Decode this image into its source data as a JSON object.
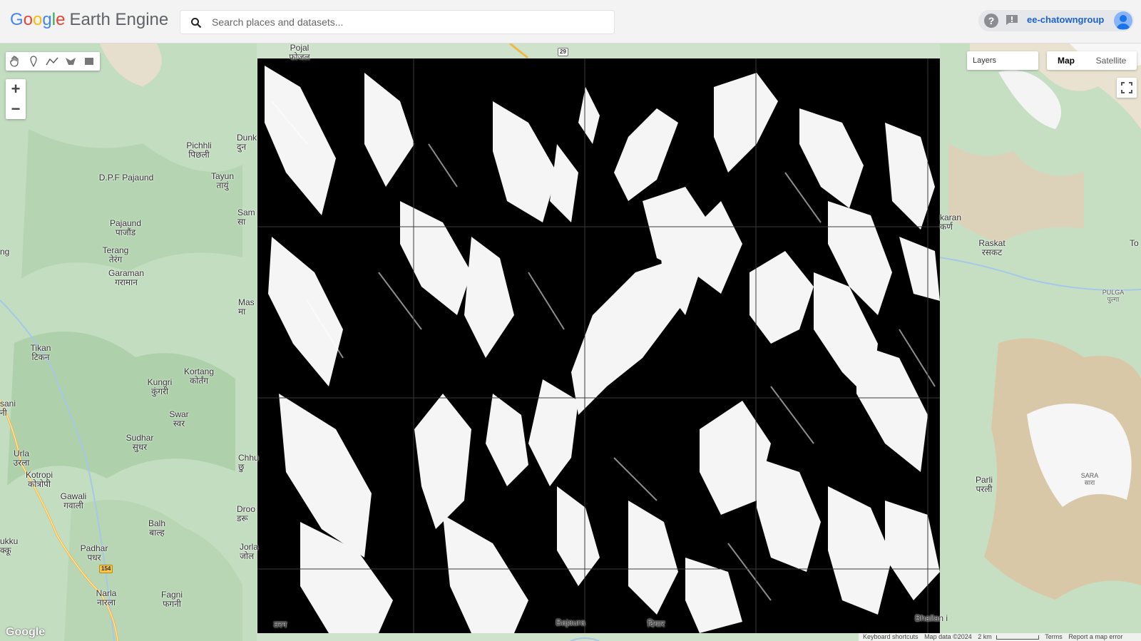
{
  "app": {
    "logo_google": [
      "G",
      "o",
      "o",
      "g",
      "l",
      "e"
    ],
    "logo_product": "Earth Engine"
  },
  "search": {
    "placeholder": "Search places and datasets..."
  },
  "account": {
    "help_glyph": "?",
    "username": "ee-chatowngroup"
  },
  "map_controls": {
    "tools": [
      "pan-hand",
      "point-marker",
      "line",
      "polygon",
      "rectangle"
    ],
    "zoom_in": "+",
    "zoom_out": "−",
    "layers_label": "Layers",
    "map_type": {
      "active": "Map",
      "other": "Satellite"
    }
  },
  "places": [
    {
      "name": "Pojal",
      "sub": "फोजल"
    },
    {
      "name": "Dunk",
      "sub": "दुन"
    },
    {
      "name": "Pichhli",
      "sub": "पिछली"
    },
    {
      "name": "D.P.F Pajaund",
      "sub": ""
    },
    {
      "name": "Tayun",
      "sub": "तायुं"
    },
    {
      "name": "Sam",
      "sub": "सा"
    },
    {
      "name": "Pajaund",
      "sub": "पाजौंड"
    },
    {
      "name": "ng",
      "sub": ""
    },
    {
      "name": "Terang",
      "sub": "तेरंग"
    },
    {
      "name": "Garaman",
      "sub": "गरामान"
    },
    {
      "name": "Mas",
      "sub": "मा"
    },
    {
      "name": "Tikan",
      "sub": "टिकन"
    },
    {
      "name": "Kortang",
      "sub": "कोर्तंग"
    },
    {
      "name": "Kungri",
      "sub": "कुंगरी"
    },
    {
      "name": "sani",
      "sub": "नी"
    },
    {
      "name": "Swar",
      "sub": "स्वर"
    },
    {
      "name": "Sudhar",
      "sub": "सुधर"
    },
    {
      "name": "Urla",
      "sub": "उरला"
    },
    {
      "name": "Chhu",
      "sub": "छु"
    },
    {
      "name": "Kotropi",
      "sub": "कोत्रोपी"
    },
    {
      "name": "Gawali",
      "sub": "गवाली"
    },
    {
      "name": "Balh",
      "sub": "बाल्ह"
    },
    {
      "name": "Droo",
      "sub": "डरू"
    },
    {
      "name": "ukku",
      "sub": "क्कू"
    },
    {
      "name": "Padhar",
      "sub": "पधर"
    },
    {
      "name": "Jorla",
      "sub": "जोल"
    },
    {
      "name": "Narla",
      "sub": "नारला"
    },
    {
      "name": "Fagni",
      "sub": "फगनी"
    },
    {
      "name": "karan",
      "sub": "कर्ण"
    },
    {
      "name": "Raskat",
      "sub": "रसकट"
    },
    {
      "name": "To",
      "sub": ""
    },
    {
      "name": "PULGA",
      "sub": "पुल्गा"
    },
    {
      "name": "Parli",
      "sub": "परली"
    },
    {
      "name": "SARA",
      "sub": "सारा"
    },
    {
      "name": "Bajaura",
      "sub": ""
    },
    {
      "name": "तरन",
      "sub": ""
    },
    {
      "name": "दियार",
      "sub": ""
    },
    {
      "name": "Bhallan i",
      "sub": ""
    }
  ],
  "road_shields": [
    "29",
    "154"
  ],
  "attribution": {
    "google": "Google",
    "keyboard": "Keyboard shortcuts",
    "map_data": "Map data ©2024",
    "scale": "2 km",
    "terms": "Terms",
    "report": "Report a map error"
  }
}
